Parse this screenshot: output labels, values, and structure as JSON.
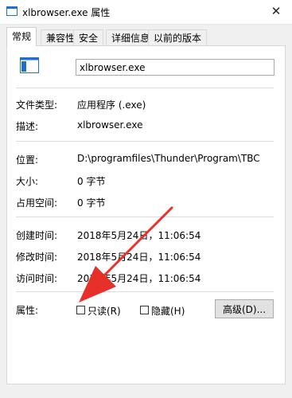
{
  "window": {
    "title": "xlbrowser.exe 属性",
    "close_glyph": "✕"
  },
  "tabs": [
    {
      "label": "常规",
      "active": true
    },
    {
      "label": "兼容性",
      "active": false
    },
    {
      "label": "安全",
      "active": false
    },
    {
      "label": "详细信息",
      "active": false
    },
    {
      "label": "以前的版本",
      "active": false
    }
  ],
  "general": {
    "filename": "xlbrowser.exe",
    "file_type_label": "文件类型:",
    "file_type_value": "应用程序 (.exe)",
    "description_label": "描述:",
    "description_value": "xlbrowser.exe",
    "location_label": "位置:",
    "location_value": "D:\\programfiles\\Thunder\\Program\\TBC",
    "size_label": "大小:",
    "size_value": "0 字节",
    "size_on_disk_label": "占用空间:",
    "size_on_disk_value": "0 字节",
    "created_label": "创建时间:",
    "created_value": "2018年5月24日，11:06:54",
    "modified_label": "修改时间:",
    "modified_value": "2018年5月24日，11:06:54",
    "accessed_label": "访问时间:",
    "accessed_value": "2018年5月24日，11:06:54",
    "attributes_label": "属性:",
    "readonly_label": "只读(R)",
    "readonly_checked": false,
    "hidden_label": "隐藏(H)",
    "hidden_checked": false,
    "advanced_label": "高级(D)..."
  },
  "colors": {
    "annotation_arrow": "#e8302a",
    "icon_blue": "#1e6fd0"
  }
}
